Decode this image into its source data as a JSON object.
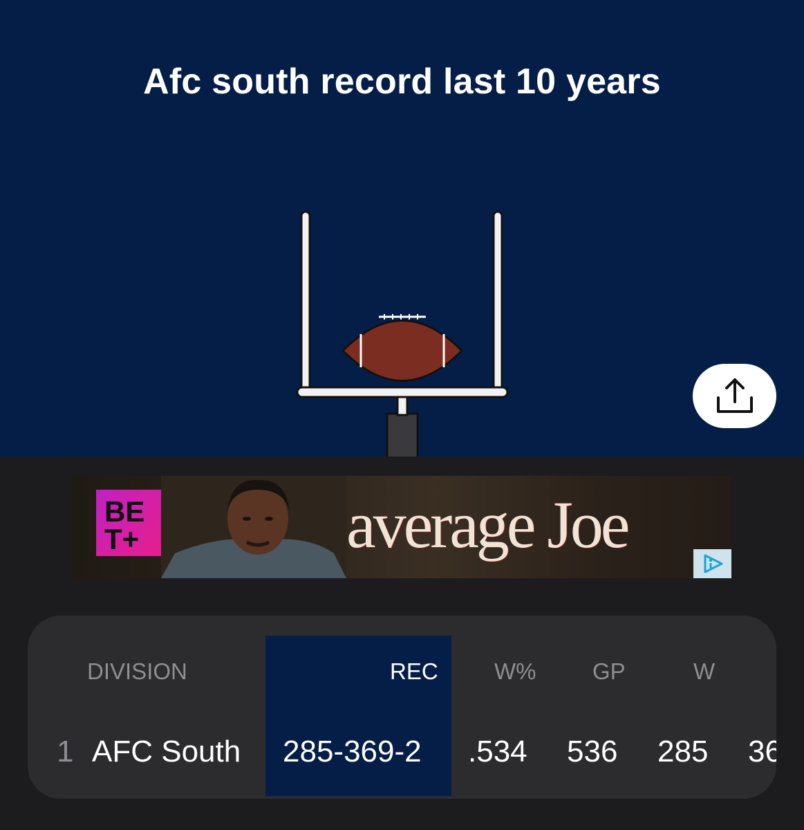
{
  "hero": {
    "title": "Afc south record last 10 years",
    "background_color": "#041e48",
    "illustration": "goalpost-football-icon",
    "share_icon": "share-icon"
  },
  "ad": {
    "brand_logo_text": "BE T+",
    "title": "average Joe",
    "ad_choices_icon": "ad-choices-icon"
  },
  "table": {
    "headers": [
      "DIVISION",
      "REC",
      "W%",
      "GP",
      "W"
    ],
    "rows": [
      {
        "rank": "1",
        "division": "AFC South",
        "rec": "285-369-2",
        "win_pct": ".534",
        "gp": "536",
        "w": "285",
        "next_partial": "36"
      }
    ],
    "highlight_color": "#041e48"
  }
}
